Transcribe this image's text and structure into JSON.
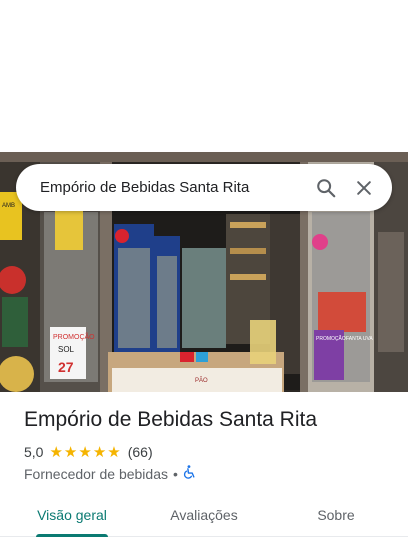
{
  "search": {
    "query": "Empório de Bebidas Santa Rita"
  },
  "place": {
    "name": "Empório de Bebidas Santa Rita",
    "rating": "5,0",
    "stars": 5,
    "review_count": "(66)",
    "category": "Fornecedor de bebidas",
    "separator": "•"
  },
  "photo": {
    "signs": [
      "PROMOÇÃO",
      "SOL",
      "27",
      "PROMOÇÃO",
      "FANTA UVA",
      "PÃO",
      "AMB"
    ]
  },
  "tabs": [
    {
      "label": "Visão geral",
      "active": true
    },
    {
      "label": "Avaliações",
      "active": false
    },
    {
      "label": "Sobre",
      "active": false
    }
  ],
  "colors": {
    "accent": "#0b7a72",
    "star": "#f5b400",
    "accessibility": "#1a73e8"
  }
}
